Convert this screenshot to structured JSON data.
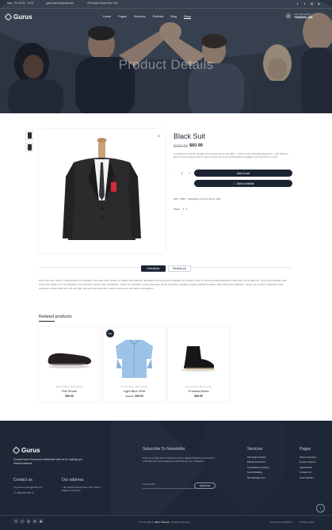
{
  "topbar": {
    "phone": "Mon - Fri: 10:00 - 10:00",
    "email": "gurus.servise@mail.com",
    "address": "25 Victoria Street New York",
    "social_icons": [
      "facebook-icon",
      "twitter-icon",
      "instagram-icon",
      "linkedin-icon"
    ]
  },
  "nav": {
    "logo": "Gurus",
    "menu": [
      "Home",
      "Pages",
      "Services",
      "Portfolio",
      "Blog",
      "Shop"
    ],
    "active_item": "Shop",
    "phone_label": "Free Tell Number",
    "phone_number": "+000(000) 456"
  },
  "hero": {
    "title": "Product Details"
  },
  "product": {
    "title": "Black Suit",
    "old_price": "$120.00",
    "price": "$60.99",
    "description": "A collection of textile samples lay spread out on the table – Samsa was travelling salesman – and above it there hung a picture that he had recently cut out of an illustrated magazine and housed in a nice.",
    "qty_minus": "-",
    "qty_value": "1",
    "qty_plus": "+",
    "add_to_cart": "Add to cart",
    "add_to_wishlist": "Add to wishlist",
    "sku_label": "SKU:",
    "sku": "0908",
    "categories_label": "Categories:",
    "categories": "Area & Polos, Man",
    "share_label": "Share:",
    "share_icons": [
      "facebook-icon",
      "twitter-icon"
    ]
  },
  "tabs": [
    {
      "label": "Description",
      "active": true
    },
    {
      "label": "Reviews (0)",
      "active": false
    }
  ],
  "long_description": "Duis aute irure dolor in reprehenderit in voluptate velit esse cillum dolore eu fugiat nulla pariatur. Excepteur sint occaecat cupidatat non proident, sunt in culpa qui officia deserunt mollit anim id est laborum. Sed ut perspiciatis unde omnis iste natus error sit voluptatem accusantium doloremque laudantium, totam rem aperiam, eaque ipsa quae ab illo inventore veritatis et quasi architecto beatae vitae dicta sunt explicabo. Nemo enim ipsam voluptatem quia voluptas sit aspernatur aut odit aut fugit, sed quia consequuntur magni dolores eos qui ratione voluptatem.",
  "related": {
    "title": "Related products",
    "items": [
      {
        "category": "Area & Polos, Sport Levels",
        "name": "Flat Shoes",
        "old_price": "",
        "price": "$59.99",
        "badge": ""
      },
      {
        "category": "Area & Polos, Sport Levels",
        "name": "Light Blue Shirt",
        "old_price": "$56.00",
        "price": "$49.99",
        "badge": "Sale"
      },
      {
        "category": "Area & Polos, Sport Levels",
        "name": "Chelsea Boots",
        "old_price": "",
        "price": "$69.99",
        "badge": ""
      }
    ]
  },
  "footer": {
    "logo": "Gurus",
    "about": "Contact team Gurus and collaborate with us for making you dream business",
    "newsletter_title": "Subscribe To Newsletter",
    "newsletter_text": "Stay up-to-date with the latest trends in digital marketing and receive exclusive tips and insights by subscribing to our newsletter.",
    "email_placeholder": "Your E-mail",
    "subscribe_button": "Subscribe",
    "contact_title": "Contact us",
    "contact_email": "gurus.servise@mail.com",
    "contact_phone": "+098 056 486 11",
    "address_title": "Our address",
    "address": "26 Victoria Street New York United States of America",
    "services_title": "Services",
    "services": [
      "Financial Analysis",
      "Market Research",
      "Competitive Analysis",
      "Team Building",
      "HR Management"
    ],
    "pages_title": "Pages",
    "pages": [
      "About Company",
      "Career Options",
      "Applications",
      "Contact Us",
      "Case Studies"
    ],
    "copyright_prefix": "© Copyright by",
    "copyright_brand": "Bicro Themes",
    "copyright_suffix": ". All rights reserved",
    "bottom_links": [
      "Terms and conditions",
      "Privacy policy"
    ],
    "social_icons": [
      "facebook-icon",
      "twitter-icon",
      "instagram-icon",
      "linkedin-icon",
      "youtube-icon"
    ]
  }
}
